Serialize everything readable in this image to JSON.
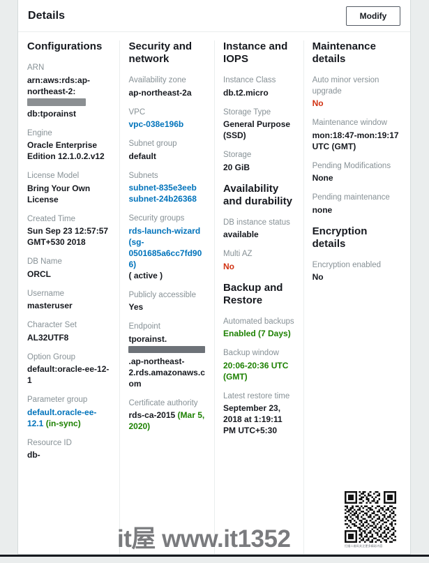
{
  "header": {
    "title": "Details",
    "modify_label": "Modify"
  },
  "columns": {
    "configurations": {
      "heading": "Configurations",
      "fields": [
        {
          "label": "ARN",
          "value_pre": "arn:aws:rds:ap-northeast-2:",
          "redacted": true,
          "value_post": "db:tporainst"
        },
        {
          "label": "Engine",
          "value": "Oracle Enterprise Edition 12.1.0.2.v12"
        },
        {
          "label": "License Model",
          "value": "Bring Your Own License"
        },
        {
          "label": "Created Time",
          "value": "Sun Sep 23 12:57:57 GMT+530 2018"
        },
        {
          "label": "DB Name",
          "value": "ORCL"
        },
        {
          "label": "Username",
          "value": "masteruser"
        },
        {
          "label": "Character Set",
          "value": "AL32UTF8"
        },
        {
          "label": "Option Group",
          "value": "default:oracle-ee-12-1"
        },
        {
          "label": "Parameter group",
          "value": "default.oracle-ee-12.1",
          "suffix": " (in-sync)",
          "link": true
        },
        {
          "label": "Resource ID",
          "value": "db-"
        }
      ]
    },
    "security": {
      "heading": "Security and network",
      "fields": [
        {
          "label": "Availability zone",
          "value": "ap-northeast-2a"
        },
        {
          "label": "VPC",
          "value": "vpc-038e196b",
          "link": true
        },
        {
          "label": "Subnet group",
          "value": "default"
        },
        {
          "label": "Subnets",
          "value": "subnet-835e3eeb subnet-24b26368",
          "link": true
        },
        {
          "label": "Security groups",
          "value": "rds-launch-wizard (sg-0501685a6cc7fd906)",
          "suffix": " ( active )",
          "link": true
        },
        {
          "label": "Publicly accessible",
          "value": "Yes"
        },
        {
          "label": "Endpoint",
          "value_pre": "tporainst.",
          "redacted": true,
          "value_post": ".ap-northeast-2.rds.amazonaws.com"
        },
        {
          "label": "Certificate authority",
          "value": "rds-ca-2015",
          "suffix": " (Mar 5, 2020)"
        }
      ]
    },
    "instance": {
      "heading": "Instance and IOPS",
      "fields": [
        {
          "label": "Instance Class",
          "value": "db.t2.micro"
        },
        {
          "label": "Storage Type",
          "value": "General Purpose (SSD)"
        },
        {
          "label": "Storage",
          "value": "20 GiB"
        }
      ],
      "availability_heading": "Availability and durability",
      "availability_fields": [
        {
          "label": "DB instance status",
          "value": "available"
        },
        {
          "label": "Multi AZ",
          "value": "No",
          "tone": "red"
        }
      ],
      "backup_heading": "Backup and Restore",
      "backup_fields": [
        {
          "label": "Automated backups",
          "value": "Enabled (7 Days)",
          "tone": "green"
        },
        {
          "label": "Backup window",
          "value": "20:06-20:36 UTC (GMT)",
          "tone": "green"
        },
        {
          "label": "Latest restore time",
          "value": "September 23, 2018 at 1:19:11 PM UTC+5:30"
        }
      ]
    },
    "maintenance": {
      "heading": "Maintenance details",
      "fields": [
        {
          "label": "Auto minor version upgrade",
          "value": "No",
          "tone": "red"
        },
        {
          "label": "Maintenance window",
          "value": "mon:18:47-mon:19:17 UTC (GMT)"
        },
        {
          "label": "Pending Modifications",
          "value": "None"
        },
        {
          "label": "Pending maintenance",
          "value": "none"
        }
      ],
      "encryption_heading": "Encryption details",
      "encryption_fields": [
        {
          "label": "Encryption enabled",
          "value": "No"
        }
      ]
    }
  },
  "watermark": {
    "text": "it屋  www.it1352",
    "qr_caption": "扫描二维码关注更多精彩内容"
  },
  "colors": {
    "link": "#0073bb",
    "danger": "#d13212",
    "success": "#1d8102",
    "label": "#879196",
    "text": "#16191f",
    "card_bg": "#ffffff",
    "page_bg": "#eaeded"
  }
}
